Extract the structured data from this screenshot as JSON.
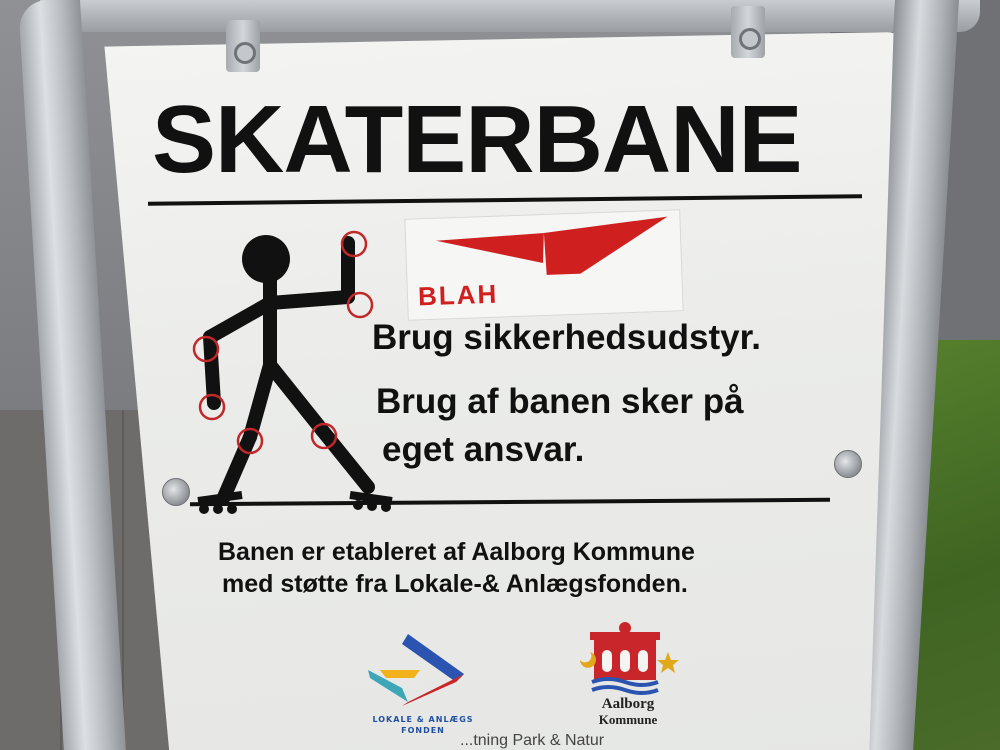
{
  "sign": {
    "title": "SKATERBANE",
    "sticker_text": "BLAH",
    "rules": [
      "Brug sikkerhedsudstyr.",
      "Brug af banen sker på",
      "eget ansvar."
    ],
    "credits": [
      "Banen er etableret af Aalborg Kommune",
      "med støtte fra Lokale-& Anlægsfonden."
    ],
    "logos": {
      "left_line1": "LOKALE & ANLÆGS",
      "left_line2": "FONDEN",
      "right_line1": "Aalborg",
      "right_line2": "Kommune"
    },
    "cut_off_text": "...tning Park & Natur"
  },
  "colors": {
    "sign_bg": "#eeeeec",
    "text": "#111111",
    "sticker_red": "#d01f1f",
    "pad_circle": "#c0282a"
  }
}
